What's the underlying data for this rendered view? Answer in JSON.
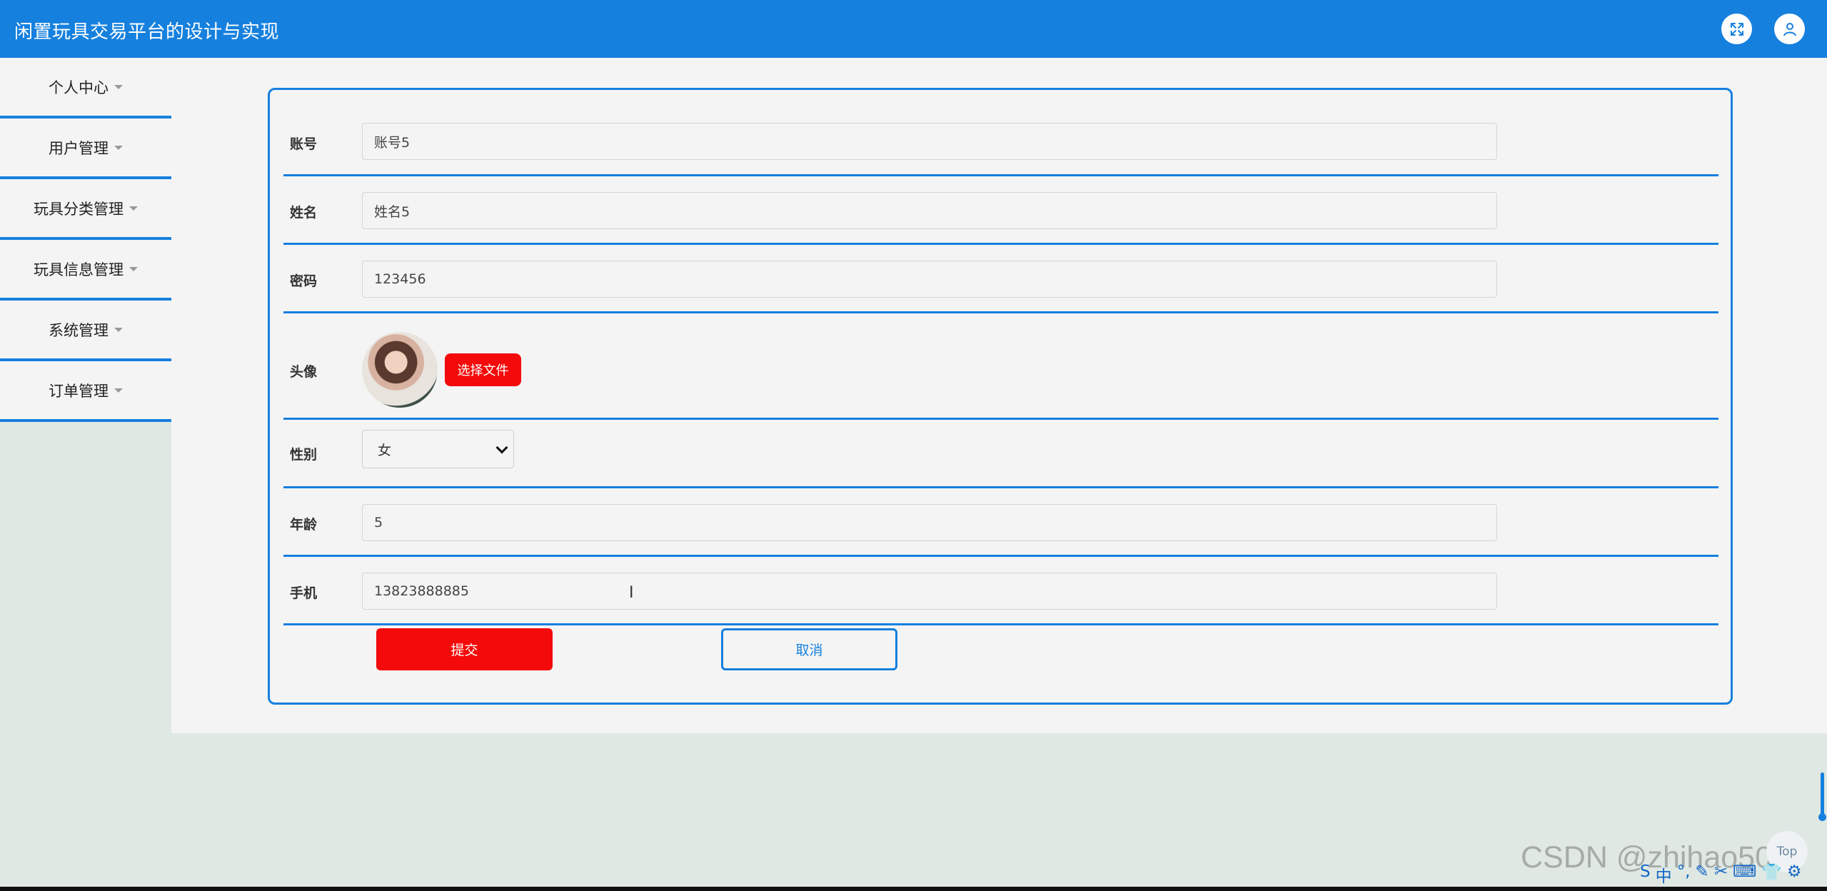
{
  "app": {
    "title": "闲置玩具交易平台的设计与实现"
  },
  "header": {
    "icons": [
      "fullscreen-icon",
      "user-icon"
    ],
    "accent_color": "#1680de"
  },
  "sidebar": {
    "items": [
      {
        "label": "个人中心"
      },
      {
        "label": "用户管理"
      },
      {
        "label": "玩具分类管理"
      },
      {
        "label": "玩具信息管理"
      },
      {
        "label": "系统管理"
      },
      {
        "label": "订单管理"
      }
    ]
  },
  "form": {
    "account": {
      "label": "账号",
      "value": "账号5"
    },
    "name": {
      "label": "姓名",
      "value": "姓名5"
    },
    "password": {
      "label": "密码",
      "value": "123456"
    },
    "avatar": {
      "label": "头像",
      "button_label": "选择文件"
    },
    "gender": {
      "label": "性别",
      "selected": "女"
    },
    "age": {
      "label": "年龄",
      "value": "5"
    },
    "phone": {
      "label": "手机",
      "value": "13823888885"
    },
    "submit_label": "提交",
    "cancel_label": "取消"
  },
  "widgets": {
    "top_button_label": "Top",
    "watermark": "CSDN @zhihao506"
  },
  "ime": {
    "items": [
      "S",
      "中",
      "°,",
      "✎",
      "✂",
      "⌨",
      "👕",
      "⚙"
    ]
  }
}
